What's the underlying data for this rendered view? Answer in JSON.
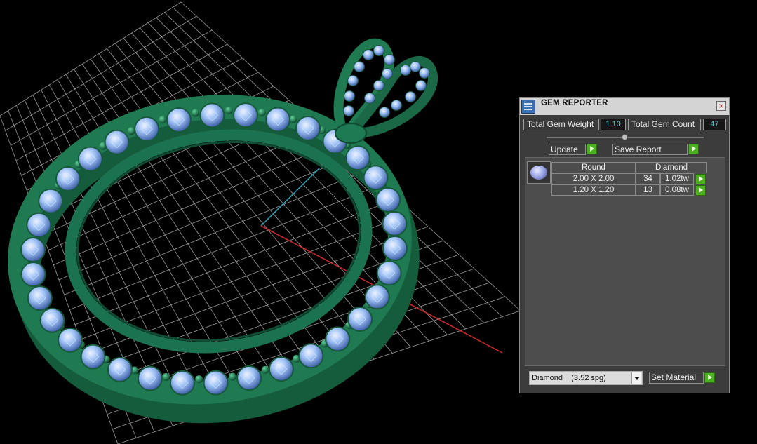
{
  "viewport": {
    "background": "#000000",
    "grid_color": "#9a9a9a",
    "axis_x_color": "#d22a2a",
    "axis_y_color": "#2aa7b8",
    "metal_color": "#1f7a52",
    "gem_color": "#8fb8f2",
    "object": "round-halo-pendant"
  },
  "panel": {
    "title": "GEM REPORTER",
    "icon": "gem-reporter-app-icon",
    "close_icon": "close-icon",
    "total_weight_label": "Total Gem Weight",
    "total_weight_value": "1.10",
    "total_count_label": "Total Gem Count",
    "total_count_value": "47",
    "update_label": "Update",
    "save_report_label": "Save Report",
    "table": {
      "headers": [
        "Round",
        "Diamond"
      ],
      "rows": [
        {
          "size": "2.00 X 2.00",
          "count": "34",
          "weight": "1.02tw"
        },
        {
          "size": "1.20 X 1.20",
          "count": "13",
          "weight": "0.08tw"
        }
      ]
    },
    "material_select": "Diamond    (3.52 spg)",
    "set_material_label": "Set Material",
    "accent_go_color": "#4bb01f"
  }
}
